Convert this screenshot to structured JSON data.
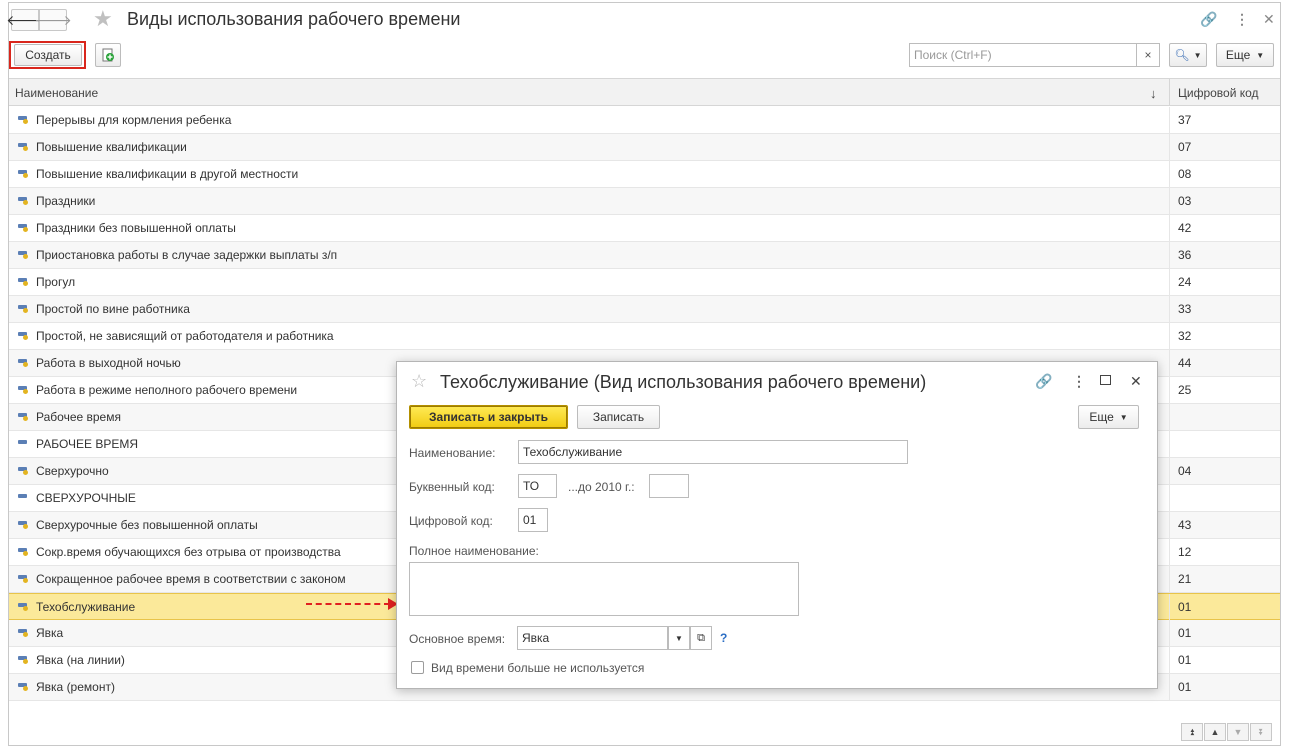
{
  "window": {
    "title": "Виды использования рабочего времени",
    "back_icon": "arrow-left-icon",
    "forward_icon": "arrow-right-icon"
  },
  "toolbar": {
    "create_label": "Создать",
    "search_placeholder": "Поиск (Ctrl+F)",
    "search_clear": "×",
    "more_label": "Еще"
  },
  "table": {
    "columns": [
      "Наименование",
      "Цифровой код"
    ],
    "sort_indicator": "↓",
    "rows": [
      {
        "name": "Перерывы для кормления ребенка",
        "code": "37"
      },
      {
        "name": "Повышение квалификации",
        "code": "07"
      },
      {
        "name": "Повышение квалификации в другой местности",
        "code": "08"
      },
      {
        "name": "Праздники",
        "code": "03"
      },
      {
        "name": "Праздники без повышенной оплаты",
        "code": "42"
      },
      {
        "name": "Приостановка работы в случае задержки выплаты з/п",
        "code": "36"
      },
      {
        "name": "Прогул",
        "code": "24"
      },
      {
        "name": "Простой по вине работника",
        "code": "33"
      },
      {
        "name": "Простой, не зависящий от работодателя и работника",
        "code": "32"
      },
      {
        "name": "Работа в выходной ночью",
        "code": "44"
      },
      {
        "name": "Работа в режиме неполного рабочего времени",
        "code": "25"
      },
      {
        "name": "Рабочее время",
        "code": ""
      },
      {
        "name": "РАБОЧЕЕ ВРЕМЯ",
        "code": ""
      },
      {
        "name": "Сверхурочно",
        "code": "04"
      },
      {
        "name": "СВЕРХУРОЧНЫЕ",
        "code": ""
      },
      {
        "name": "Сверхурочные без повышенной оплаты",
        "code": "43"
      },
      {
        "name": "Сокр.время обучающихся без отрыва от производства",
        "code": "12"
      },
      {
        "name": "Сокращенное рабочее время в соответствии с законом",
        "code": "21"
      },
      {
        "name": "Техобслуживание",
        "code": "01"
      },
      {
        "name": "Явка",
        "code": "01"
      },
      {
        "name": "Явка (на линии)",
        "code": "01"
      },
      {
        "name": "Явка (ремонт)",
        "code": "01"
      }
    ]
  },
  "dialog": {
    "title": "Техобслуживание (Вид использования рабочего времени)",
    "save_close_label": "Записать и закрыть",
    "save_label": "Записать",
    "more_label": "Еще",
    "name_label": "Наименование:",
    "name_value": "Техобслуживание",
    "letter_code_label": "Буквенный код:",
    "letter_code_value": "ТО",
    "before2010_label": "...до 2010 г.:",
    "before2010_value": "",
    "digit_code_label": "Цифровой код:",
    "digit_code_value": "01",
    "full_name_label": "Полное наименование:",
    "full_name_value": "",
    "main_time_label": "Основное время:",
    "main_time_value": "Явка",
    "help_mark": "?",
    "not_used_label": "Вид времени больше не используется"
  }
}
